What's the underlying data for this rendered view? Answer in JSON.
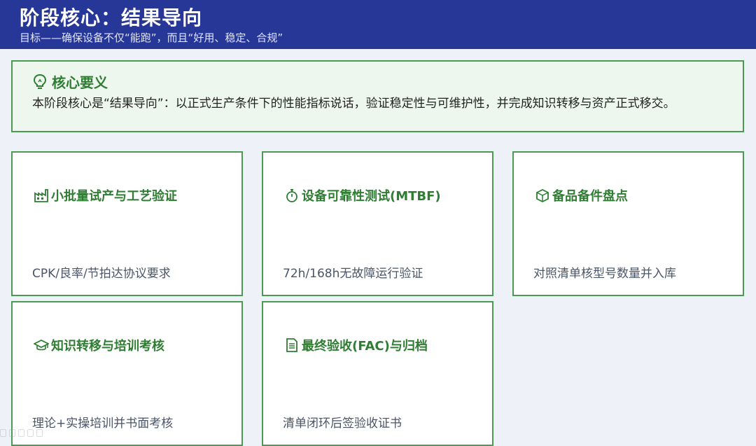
{
  "header": {
    "title": "阶段核心：结果导向",
    "subtitle": "目标——确保设备不仅“能跑”，而且“好用、稳定、合规”"
  },
  "core": {
    "icon": "lightbulb-icon",
    "title": "核心要义",
    "text": "本阶段核心是“结果导向”：以正式生产条件下的性能指标说话，验证稳定性与可维护性，并完成知识转移与资产正式移交。"
  },
  "cards": [
    {
      "icon": "factory-icon",
      "title": "小批量试产与工艺验证",
      "desc": "CPK/良率/节拍达协议要求"
    },
    {
      "icon": "stopwatch-icon",
      "title": "设备可靠性测试(MTBF)",
      "desc": "72h/168h无故障运行验证"
    },
    {
      "icon": "box-icon",
      "title": "备品备件盘点",
      "desc": "对照清单核型号数量并入库"
    },
    {
      "icon": "graduation-cap-icon",
      "title": "知识转移与培训考核",
      "desc": "理论+实操培训并书面考核"
    },
    {
      "icon": "document-icon",
      "title": "最终验收(FAC)与归档",
      "desc": "清单闭环后签验收证书"
    }
  ],
  "colors": {
    "header_bg": "#273798",
    "accent_green": "#2f7d32",
    "border_green": "#4a9a54",
    "panel_green": "#edf7ee"
  }
}
